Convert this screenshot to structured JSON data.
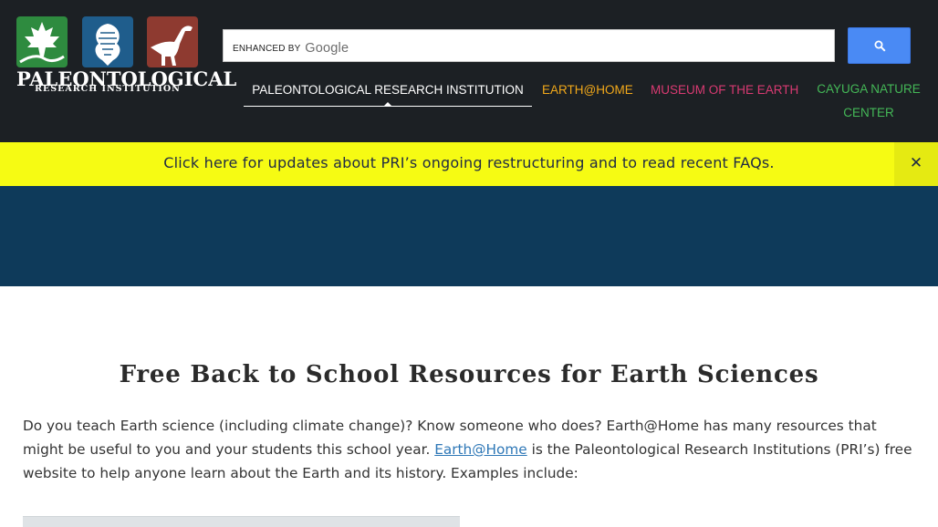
{
  "header": {
    "logo": {
      "word": "PALEONTOLOGICAL",
      "sub": "RESEARCH INSTITUTION"
    },
    "search": {
      "brand_prefix": "ENHANCED BY",
      "brand_name": "Google",
      "button_icon": "search-icon"
    },
    "nav": {
      "pri": "PALEONTOLOGICAL RESEARCH INSTITUTION",
      "earth": "EARTH@HOME",
      "museum": "MUSEUM OF THE EARTH",
      "cayuga_line1": "CAYUGA NATURE",
      "cayuga_line2": "CENTER"
    },
    "colors": {
      "header_bg": "#1c2024",
      "earth": "#f1a81a",
      "museum": "#d93a72",
      "cayuga": "#44b857"
    }
  },
  "banner": {
    "text": "Click here for updates about PRI’s ongoing restructuring and to read recent FAQs.",
    "close": "✕",
    "color": "#f6fb13"
  },
  "hero": {
    "color": "#0e3a5a"
  },
  "main": {
    "title": "Free Back to School Resources for Earth Sciences",
    "para_part1": "Do you teach Earth science (including climate change)? Know someone who does? Earth@Home has many resources that might be useful to you and your students this school year. ",
    "para_link": "Earth@Home",
    "para_part2": " is the Paleontological Research Institutions (PRI’s) free website to help anyone learn about the Earth and its history. Examples include:"
  }
}
